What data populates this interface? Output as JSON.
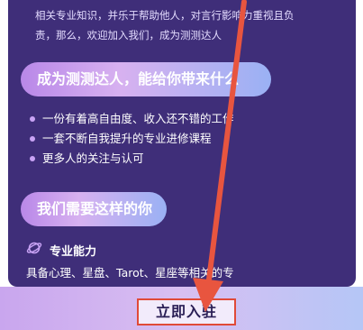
{
  "intro": {
    "line1": "相关专业知识，并乐于帮助他人，对言行影响力重视且负",
    "line2": "责，那么，欢迎加入我们，成为测测达人"
  },
  "section_benefits": {
    "title": "成为测测达人，能给你带来什么",
    "items": [
      "一份有着高自由度、收入还不错的工作",
      "一套不断自我提升的专业进修课程",
      "更多人的关注与认可"
    ]
  },
  "section_needs": {
    "title": "我们需要这样的你",
    "skill_title": "专业能力",
    "skill_desc": "具备心理、星盘、Tarot、星座等相关的专"
  },
  "join_button": {
    "label": "立即入驻"
  },
  "colors": {
    "card_background": "#3f2e79",
    "highlight_box": "#e04a38",
    "arrow": "#e8553f"
  }
}
